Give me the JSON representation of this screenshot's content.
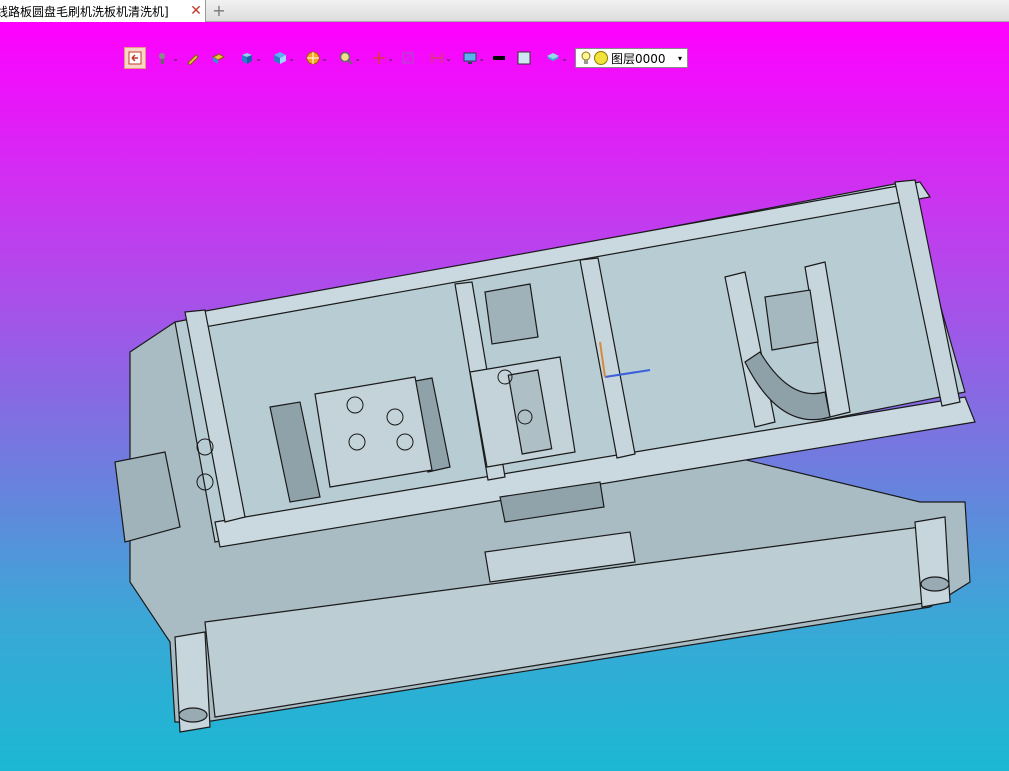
{
  "document_tab": {
    "title": "线路板圆盘毛刷机洗板机清洗机]",
    "close_glyph": "✕"
  },
  "new_tab_glyph": "+",
  "toolbar": {
    "layer_selector": {
      "value": "图层0000",
      "dropdown_glyph": "▾"
    },
    "chevron_glyph": "⌄"
  },
  "colors": {
    "background_top": "#ff00ff",
    "background_bottom": "#1bb8d4",
    "model_fill": "#b5c8d0",
    "model_edge": "#1a1a1a"
  }
}
